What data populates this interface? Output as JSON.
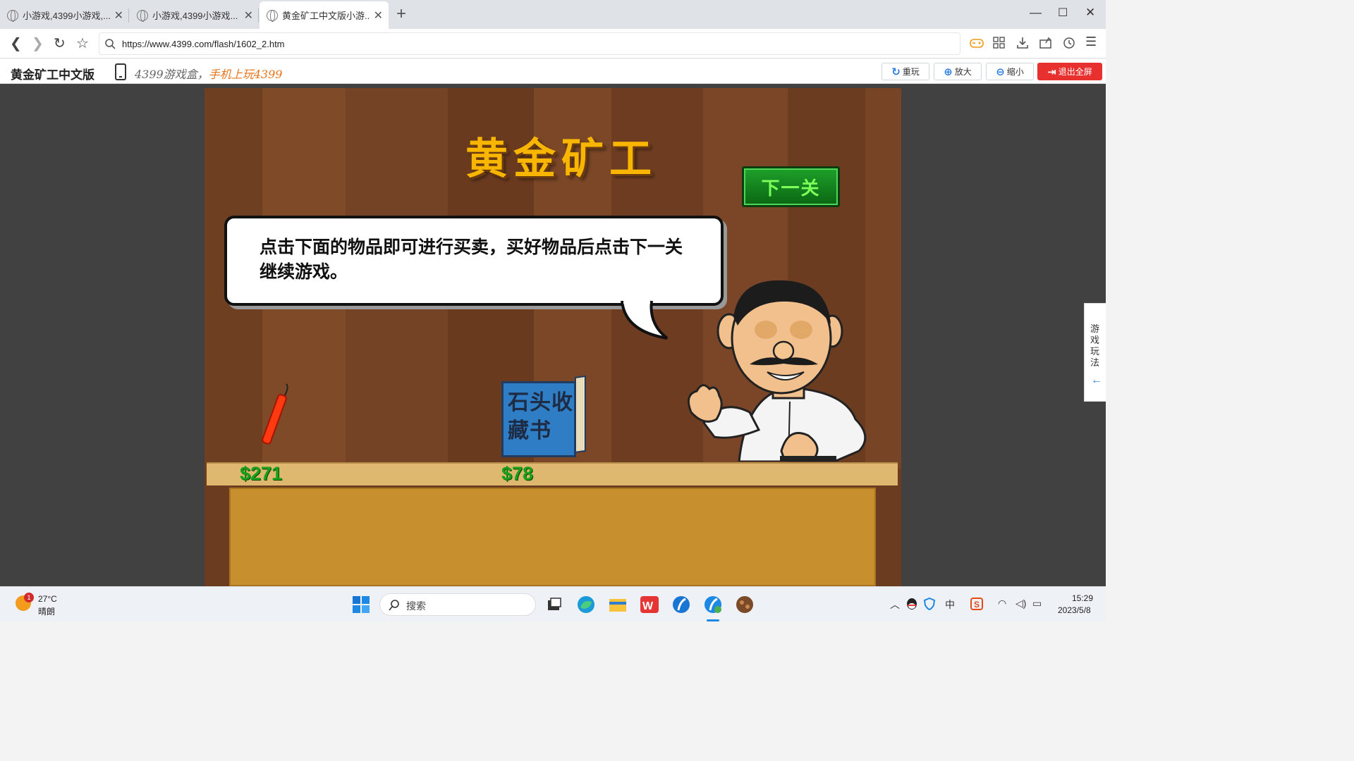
{
  "tabs": [
    {
      "title": "小游戏,4399小游戏,...",
      "active": false
    },
    {
      "title": "小游戏,4399小游戏...",
      "active": false
    },
    {
      "title": "黄金矿工中文版小游...",
      "active": true
    }
  ],
  "address_bar": {
    "url": "https://www.4399.com/flash/1602_2.htm"
  },
  "page_header": {
    "site_title": "黄金矿工中文版",
    "promo_text": "4399游戏盒，",
    "promo_highlight": "手机上玩4399",
    "buttons": {
      "replay": "重玩",
      "zoom_in": "放大",
      "zoom_out": "缩小",
      "exit_fullscreen": "退出全屏"
    }
  },
  "game": {
    "title": "黄金矿工",
    "next_level_button": "下一关",
    "speech": "点击下面的物品即可进行买卖，买好物品后点击下一关继续游戏。",
    "items": [
      {
        "name": "dynamite",
        "price": "$271"
      },
      {
        "name": "stone-collection-book",
        "label": "石头收藏书",
        "price": "$78"
      }
    ]
  },
  "side_tab": {
    "label": "游戏玩法"
  },
  "taskbar": {
    "weather": {
      "temp": "27°C",
      "condition": "晴朗",
      "badge": "1"
    },
    "search_placeholder": "搜索",
    "ime": "中",
    "time": "15:29",
    "date": "2023/5/8"
  }
}
